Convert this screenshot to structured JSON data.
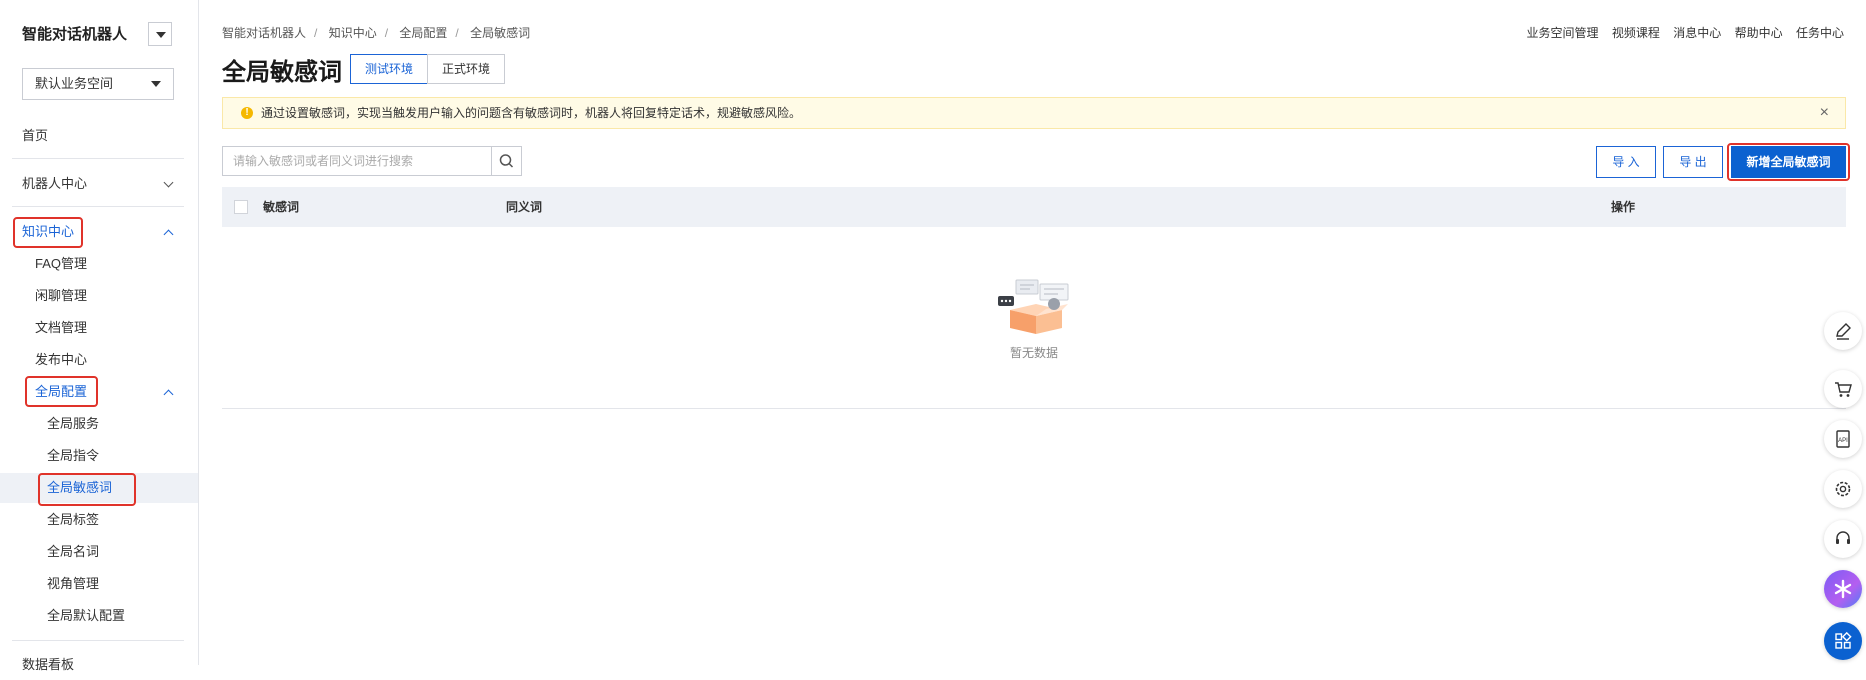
{
  "sidebar": {
    "app_title": "智能对话机器人",
    "space_select": "默认业务空间",
    "home": "首页",
    "robot_center": "机器人中心",
    "knowledge_center": "知识中心",
    "knowledge_items": [
      "FAQ管理",
      "闲聊管理",
      "文档管理",
      "发布中心"
    ],
    "global_config": "全局配置",
    "global_items": [
      "全局服务",
      "全局指令",
      "全局敏感词",
      "全局标签",
      "全局名词",
      "视角管理",
      "全局默认配置"
    ],
    "data_report": "数据看板"
  },
  "breadcrumb": [
    "智能对话机器人",
    "知识中心",
    "全局配置",
    "全局敏感词"
  ],
  "top_links": [
    "业务空间管理",
    "视频课程",
    "消息中心",
    "帮助中心",
    "任务中心"
  ],
  "page": {
    "title": "全局敏感词",
    "env_tabs": [
      "测试环境",
      "正式环境"
    ]
  },
  "notice": "通过设置敏感词，实现当触发用户输入的问题含有敏感词时，机器人将回复特定话术，规避敏感风险。",
  "search": {
    "placeholder": "请输入敏感词或者同义词进行搜索"
  },
  "actions": {
    "import": "导 入",
    "export": "导 出",
    "add": "新增全局敏感词"
  },
  "table": {
    "columns": [
      "敏感词",
      "同义词",
      "操作"
    ],
    "empty_text": "暂无数据"
  },
  "colors": {
    "accent": "#1b64d6",
    "highlight": "#e0332a",
    "notice_bg": "#fffbe6"
  }
}
